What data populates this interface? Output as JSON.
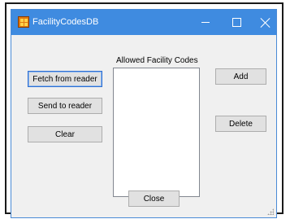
{
  "window": {
    "title": "FacilityCodesDB"
  },
  "titlebar": {
    "icon": "app-icon",
    "controls": [
      "minimize-icon",
      "maximize-icon",
      "close-icon"
    ]
  },
  "list": {
    "label": "Allowed Facility Codes",
    "items": []
  },
  "buttons": {
    "fetch": "Fetch from reader",
    "send": "Send to reader",
    "clear": "Clear",
    "add": "Add",
    "delete": "Delete",
    "close": "Close"
  },
  "colors": {
    "titlebar": "#3f8be0",
    "form_background": "#f0f0f0",
    "button_face": "#e1e1e1",
    "focus_border": "#2f6fd1"
  }
}
